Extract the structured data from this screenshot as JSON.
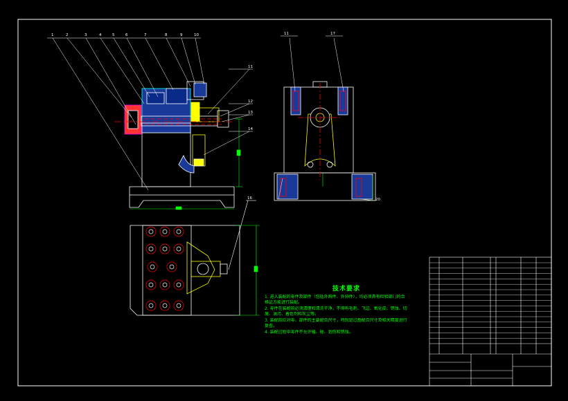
{
  "balloons_front": [
    "1",
    "2",
    "3",
    "4",
    "5",
    "6",
    "7",
    "8",
    "9",
    "10"
  ],
  "balloons_side": [
    "11",
    "12",
    "13",
    "14"
  ],
  "balloons_right": [
    "11",
    "17",
    "20"
  ],
  "balloons_plan": [
    "16"
  ],
  "notes": {
    "title": "技术要求",
    "lines": [
      "1. 进入装配的零件及部件（包括外购件、外协件），均必须具有检验部门的合",
      "   格证方能进行装配。",
      "2. 零件在装配前必须清理和清洗干净，不得有毛刺、飞边、氧化皮、锈蚀、切",
      "   屑、油污、着色剂和灰尘等。",
      "3. 装配前应对零、部件的主要配合尺寸，特别是过盈配合尺寸及相关精度进行",
      "   复查。",
      "4. 装配过程中零件不允许磕、碰、划伤和锈蚀。"
    ]
  },
  "colors": {
    "outline": "#ffffff",
    "dimension": "#00ff00",
    "hidden": "#ff0000",
    "accent": "#ffff00",
    "cut": "#ff00ff",
    "fill": "#0000aa"
  }
}
